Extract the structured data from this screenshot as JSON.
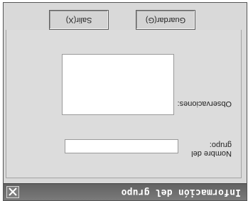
{
  "window": {
    "title": "Información del grupo",
    "close_symbol": "×"
  },
  "form": {
    "nombre_label": "Nombre del grupo:",
    "nombre_value": "",
    "observaciones_label": "Observaciones:",
    "observaciones_value": ""
  },
  "buttons": {
    "guardar": "Guardar(G)",
    "salir": "Salir(X)"
  }
}
